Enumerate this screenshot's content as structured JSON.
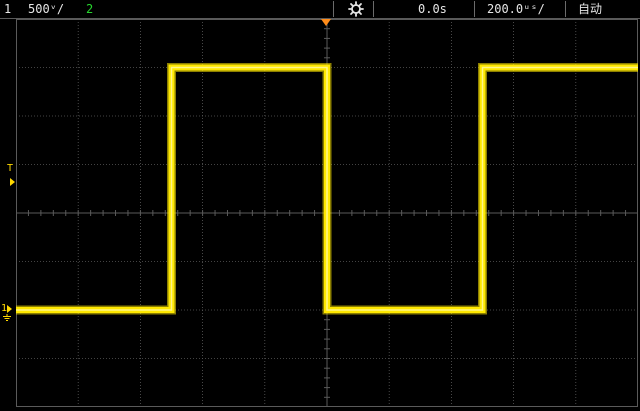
{
  "status_bar": {
    "channel1_label": "1",
    "channel1_scale": "500ᵛ/",
    "channel2_label": "2",
    "time_offset": "0.0s",
    "time_base": "200.0ᵘˢ/",
    "trigger_mode": "自动",
    "run_icon": "gear-icon"
  },
  "markers": {
    "trigger_level_label": "T",
    "channel1_marker_label": "1",
    "trigger_position_icon": "trigger-position-icon",
    "ground_icon": "ground-icon"
  },
  "colors": {
    "trace": "#ffe800",
    "grid": "#5a5a5a",
    "channel1_text": "#e6e6e6",
    "channel2_text": "#27d62e",
    "trigger_marker": "#ff8c1a",
    "background": "#000000"
  },
  "waveform": {
    "type": "square",
    "grid_divisions": [
      10,
      8
    ],
    "levels_div": {
      "high": -3,
      "low": 2
    },
    "transitions_div": [
      0,
      2.5,
      5,
      7.5
    ],
    "start_level": "low"
  }
}
